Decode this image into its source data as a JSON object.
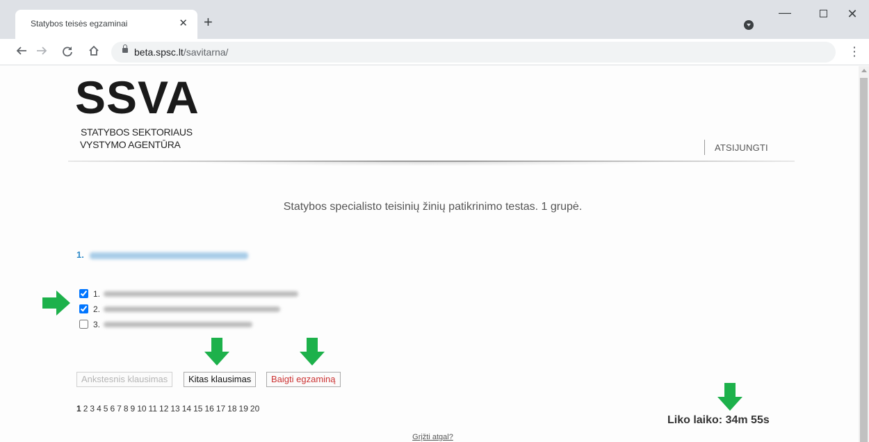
{
  "browser": {
    "tab_title": "Statybos teisės egzaminai",
    "tab_close": "✕",
    "new_tab": "+",
    "url_host": "beta.spsc.lt",
    "url_path": "/savitarna/",
    "window_minimize": "—",
    "window_close": "✕"
  },
  "header": {
    "logo": "SSVA",
    "logo_line1": "STATYBOS SEKTORIAUS",
    "logo_line2": "VYSTYMO AGENTŪRA",
    "logout": "ATSIJUNGTI"
  },
  "test": {
    "title": "Statybos specialisto teisinių žinių patikrinimo testas. 1 grupė.",
    "question_number": "1.",
    "answers": [
      {
        "number": "1.",
        "checked": true
      },
      {
        "number": "2.",
        "checked": true
      },
      {
        "number": "3.",
        "checked": false
      }
    ]
  },
  "buttons": {
    "previous": "Ankstesnis klausimas",
    "next": "Kitas klausimas",
    "finish": "Baigti egzaminą"
  },
  "pagination": {
    "current": "1",
    "pages": [
      "2",
      "3",
      "4",
      "5",
      "6",
      "7",
      "8",
      "9",
      "10",
      "11",
      "12",
      "13",
      "14",
      "15",
      "16",
      "17",
      "18",
      "19",
      "20"
    ]
  },
  "timer": "Liko laiko: 34m 55s",
  "back_link": "Grįžti atgal?",
  "colors": {
    "highlight_arrow": "#1db14b",
    "question_link": "#2f8ac8",
    "finish_text": "#cc3333"
  },
  "icons": {
    "back": "arrow-left-icon",
    "forward": "arrow-right-icon",
    "reload": "reload-icon",
    "home": "home-icon",
    "lock": "lock-icon",
    "menu": "kebab-menu-icon",
    "profile": "profile-icon",
    "annotation": "green-arrow-icon"
  }
}
